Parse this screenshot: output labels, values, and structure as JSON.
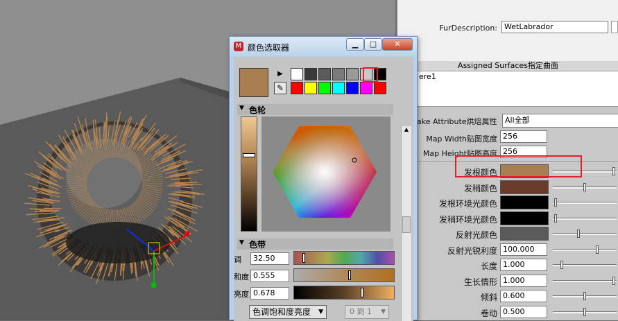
{
  "viewport": {
    "name": "maya-viewport"
  },
  "dialog": {
    "title": "颜色选取器",
    "minimize": "▁",
    "maximize": "□",
    "close": "✕",
    "current_color": "#a97e50",
    "palette": [
      "#ffffff",
      "#3a3a3a",
      "#5a5a5a",
      "#7a7a7a",
      "#9a9a9a",
      "#c8c8c8",
      "#000000",
      "#ff0000",
      "#ffff00",
      "#00ff00",
      "#00ffff",
      "#0000ff",
      "#ff00ff",
      "#ff0000"
    ],
    "color_wheel_header": "色轮",
    "color_band_header": "色带",
    "hue_label": "调",
    "hue_value": "32.50",
    "sat_label": "和度",
    "sat_value": "0.555",
    "val_label": "亮度",
    "val_value": "0.678",
    "mode_select": "色调饱和度亮度",
    "range_select": "0 到 1"
  },
  "attr_editor": {
    "fur_description_label": "FurDescription:",
    "fur_description_value": "WetLabrador",
    "assigned_surfaces_header": "Assigned Surfaces指定曲面",
    "surface_item": "ere1",
    "bake_label": "ake Attribute烘焙属性",
    "bake_value": "All全部",
    "map_width_label": "Map Width贴图宽度",
    "map_width_value": "256",
    "map_height_label": "Map Height贴图高度",
    "map_height_value": "256",
    "attributes": [
      {
        "label": "发根颜色",
        "type": "color",
        "color": "#a97e50",
        "slider": 0.98
      },
      {
        "label": "发稍颜色",
        "type": "color",
        "color": "#6a3a2a",
        "slider": 0.5
      },
      {
        "label": "发根环境光颜色",
        "type": "color",
        "color": "#000000",
        "slider": 0.02
      },
      {
        "label": "发稍环境光颜色",
        "type": "color",
        "color": "#000000",
        "slider": 0.02
      },
      {
        "label": "反射光颜色",
        "type": "color",
        "color": "#5a5a5a",
        "slider": 0.4
      },
      {
        "label": "反射光锐利度",
        "type": "value",
        "value": "100.000",
        "slider": 0.7
      },
      {
        "label": "长度",
        "type": "value",
        "value": "1.000",
        "slider": 0.12
      },
      {
        "label": "生长情形",
        "type": "value",
        "value": "1.000",
        "slider": 0.98
      },
      {
        "label": "倾斜",
        "type": "value",
        "value": "0.600",
        "slider": 0.5
      },
      {
        "label": "卷动",
        "type": "value",
        "value": "0.500",
        "slider": 0.5
      }
    ]
  }
}
